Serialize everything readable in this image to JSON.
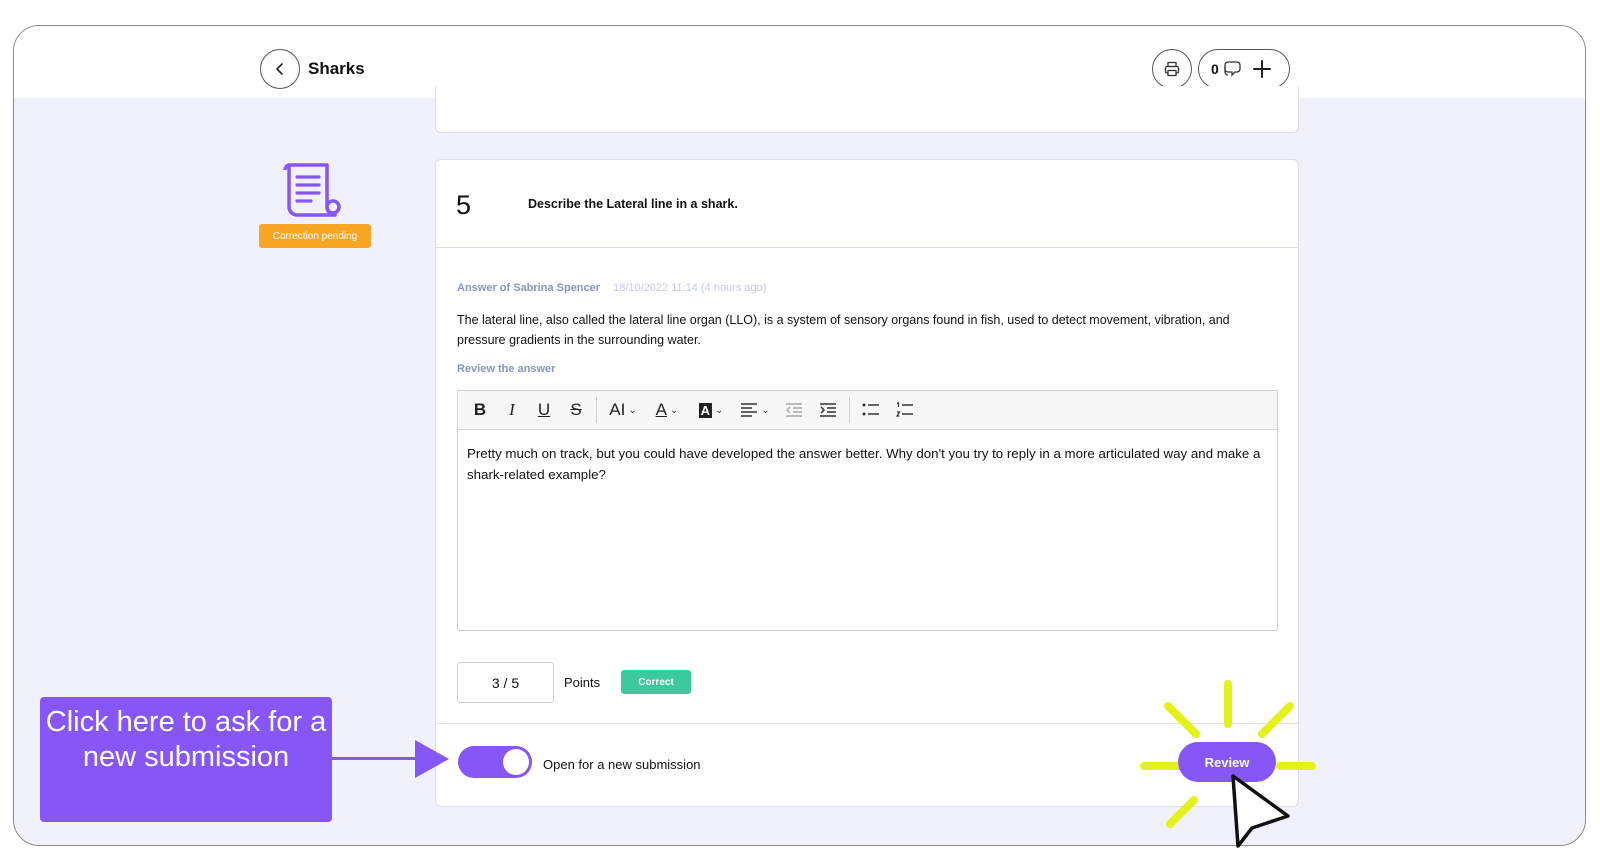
{
  "header": {
    "title": "Sharks",
    "comment_count": "0"
  },
  "status": {
    "icon": "document-scroll-icon",
    "badge": "Correction pending"
  },
  "question": {
    "number": "5",
    "text": "Describe the Lateral line in a shark."
  },
  "answer": {
    "author": "Answer of Sabrina Spencer",
    "date": "18/10/2022 11:14 (4 hours ago)",
    "text": "The lateral line, also called the lateral line organ (LLO), is a system of sensory organs found in fish, used to detect movement, vibration, and pressure gradients in the surrounding water."
  },
  "review": {
    "label": "Review the answer",
    "text": "Pretty much on track, but you could have developed the answer better. Why don't you try to reply in a more articulated way and make a shark-related example?"
  },
  "editor_toolbar": {
    "bold": "B",
    "italic": "I",
    "underline": "U",
    "strike": "S",
    "font_size": "AI",
    "font_color": "A",
    "highlight": "A"
  },
  "grading": {
    "points_value": "3 / 5",
    "points_label": "Points",
    "result_badge": "Correct"
  },
  "submission": {
    "toggle_on": true,
    "toggle_label": "Open for a new submission",
    "review_button": "Review"
  },
  "callout": {
    "text": "Click here to ask for a new submission"
  },
  "colors": {
    "accent": "#8656f6",
    "pending": "#f6a623",
    "correct": "#3cc99e",
    "highlight": "#e3f21a"
  }
}
